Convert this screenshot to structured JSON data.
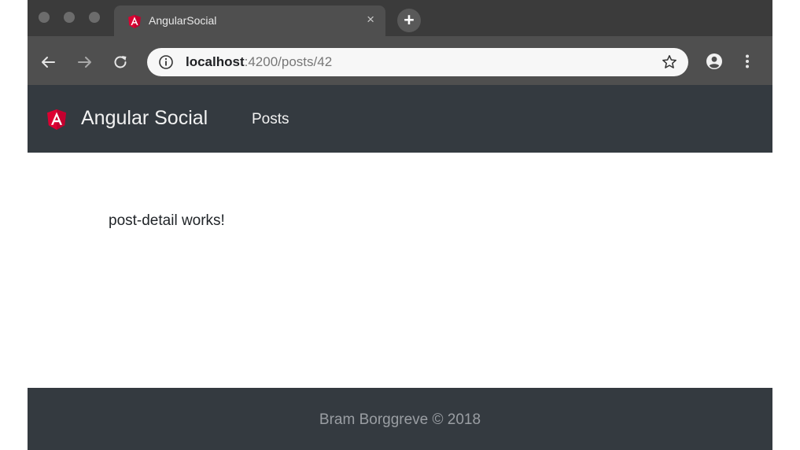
{
  "browser": {
    "tab": {
      "title": "AngularSocial",
      "close_glyph": "×",
      "favicon": "angular-icon"
    },
    "new_tab_glyph": "+",
    "url": {
      "host": "localhost",
      "path": ":4200/posts/42"
    },
    "icons": {
      "back": "arrow-left-icon",
      "forward": "arrow-right-icon",
      "reload": "reload-icon",
      "info": "info-icon",
      "bookmark": "star-icon",
      "account": "account-icon",
      "menu": "kebab-menu-icon"
    }
  },
  "app": {
    "brand": {
      "name": "Angular Social",
      "logo": "angular-icon"
    },
    "nav": {
      "posts_label": "Posts"
    },
    "content": {
      "message": "post-detail works!"
    },
    "footer": {
      "text": "Bram Borggreve © 2018"
    }
  },
  "colors": {
    "navbar_bg": "#343a40",
    "angular_red": "#dd0031",
    "footer_text": "#9a9ea3"
  }
}
